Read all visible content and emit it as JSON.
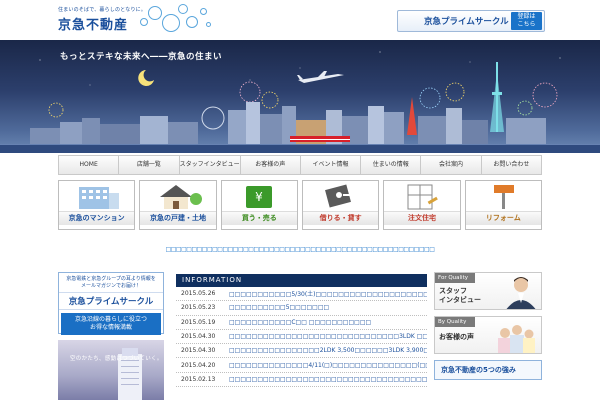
{
  "header": {
    "tagline": "住まいのそばで、暮らしのとなりに。",
    "logo": "京急不動産",
    "member_button": "京急プライムサークル",
    "register_button": "登録は\nこちら"
  },
  "hero": {
    "slogan": "もっとステキな未来へ――京急の住まい"
  },
  "nav": [
    "HOME",
    "店舗一覧",
    "スタッフインタビュー",
    "お客様の声",
    "イベント情報",
    "住まいの情報",
    "会社案内",
    "お問い合わせ"
  ],
  "categories": [
    {
      "label": "京急のマンション",
      "icon": "building-icon",
      "color": "#1a4f9c"
    },
    {
      "label": "京急の戸建・土地",
      "icon": "house-icon",
      "color": "#1a4f9c"
    },
    {
      "label": "買う・売る",
      "icon": "cash-icon",
      "color": "#3b8b1e"
    },
    {
      "label": "借りる・貸す",
      "icon": "key-icon",
      "color": "#c0392b"
    },
    {
      "label": "注文住宅",
      "icon": "floorplan-icon",
      "color": "#c0392b"
    },
    {
      "label": "リフォーム",
      "icon": "paint-roller-icon",
      "color": "#b0701a"
    }
  ],
  "notice": "□□□□□□□□□□□□□□□□□□□□□□□□□□□□□□□□□□□□□□□□□□□□□□□□□□□□",
  "left": {
    "intro": "京急電鉄と京急グループの耳より情報を\nメールマガジンでお届け！",
    "name": "京急プライムサークル",
    "desc": "京急沿線の暮らしに役立つ\nお得な情報満載",
    "promo_text": "空のかたち、感動はつづいていく。"
  },
  "info": {
    "heading": "INFORMATION",
    "items": [
      {
        "date": "2015.05.26",
        "text": "□□□□□□□□□□□5/30(土)□□□□□□□□□□□□□□□□□□□□□□□□□□□□"
      },
      {
        "date": "2015.05.23",
        "text": "□□□□□□□□□□5□□□□□□□"
      },
      {
        "date": "2015.05.19",
        "text": "□□□□□□□□□□□C□□ □□□□□□□□□□□"
      },
      {
        "date": "2015.04.30",
        "text": "□□□□□□□□□□□□□□□□□□□□□□□□□□□□□□3LDK □□□□□□□"
      },
      {
        "date": "2015.04.30",
        "text": "□□□□□□□□□□□□□□□□2LDK 3,500□□□□□□3LDK 3,900□□□□□"
      },
      {
        "date": "2015.04.20",
        "text": "□□□□□□□□□□□□□□4/11(□)□□□□□□□□□□□□□□□(□□□)"
      },
      {
        "date": "2015.02.13",
        "text": "□□□□□□□□□□□□□□□□□□□□□□□□□□□□□□□□□□□□□□□□"
      }
    ]
  },
  "right": {
    "staff_label": "For Quality",
    "staff_title": "スタッフ\nインタビュー",
    "voice_label": "By Quality",
    "voice_title": "お客様の声",
    "strength": "京急不動産の5つの強み"
  }
}
